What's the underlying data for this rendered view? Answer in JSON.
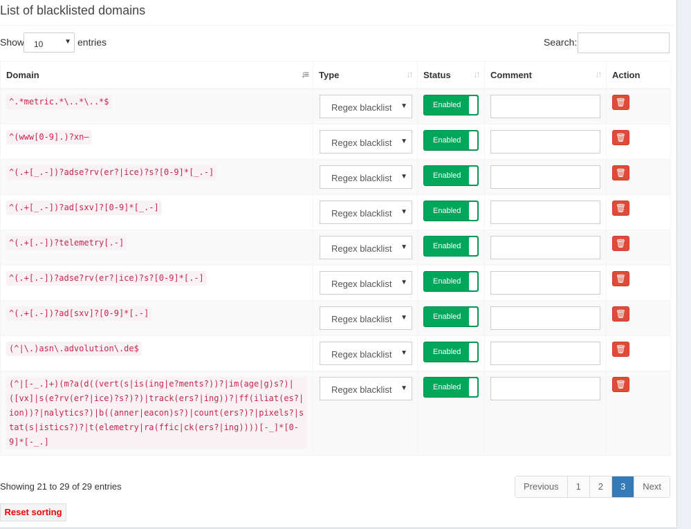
{
  "box": {
    "title": "List of blacklisted domains"
  },
  "controls": {
    "show_label": "Show",
    "entries_label": "entries",
    "length_value": "10",
    "search_label": "Search:"
  },
  "columns": {
    "domain": "Domain",
    "type": "Type",
    "status": "Status",
    "comment": "Comment",
    "action": "Action"
  },
  "rows": [
    {
      "domain": "^.*metric.*\\..*\\..*$",
      "type": "Regex blacklist",
      "status": "Enabled",
      "comment": ""
    },
    {
      "domain": "^(www[0-9].)?xn–",
      "type": "Regex blacklist",
      "status": "Enabled",
      "comment": ""
    },
    {
      "domain": "^(.+[_.-])?adse?rv(er?|ice)?s?[0-9]*[_.-]",
      "type": "Regex blacklist",
      "status": "Enabled",
      "comment": ""
    },
    {
      "domain": "^(.+[_.-])?ad[sxv]?[0-9]*[_.-]",
      "type": "Regex blacklist",
      "status": "Enabled",
      "comment": ""
    },
    {
      "domain": "^(.+[.-])?telemetry[.-]",
      "type": "Regex blacklist",
      "status": "Enabled",
      "comment": ""
    },
    {
      "domain": "^(.+[.-])?adse?rv(er?|ice)?s?[0-9]*[.-]",
      "type": "Regex blacklist",
      "status": "Enabled",
      "comment": ""
    },
    {
      "domain": "^(.+[.-])?ad[sxv]?[0-9]*[.-]",
      "type": "Regex blacklist",
      "status": "Enabled",
      "comment": ""
    },
    {
      "domain": "(^|\\.)asn\\.advolution\\.de$",
      "type": "Regex blacklist",
      "status": "Enabled",
      "comment": ""
    },
    {
      "domain": "(^|[-_.]+)(m?a(d((vert(s|is(ing|e?ments?))?|im(age|g)s?)|([vx]|s(e?rv(er?|ice)?s?)?)|track(ers?|ing))?|ff(iliat(es?|ion))?|nalytics?)|b((anner|eacon)s?)|count(ers?)?|pixels?|stat(s|istics?)?|t(elemetry|ra(ffic|ck(ers?|ing))))[-_]*[0-9]*[-_.]",
      "type": "Regex blacklist",
      "status": "Enabled",
      "comment": ""
    }
  ],
  "info": "Showing 21 to 29 of 29 entries",
  "pagination": {
    "previous": "Previous",
    "pages": [
      "1",
      "2",
      "3"
    ],
    "active_page": "3",
    "next": "Next"
  },
  "reset_label": "Reset sorting",
  "icons": {
    "trash": "trash-icon",
    "sort": "sort-icon",
    "caret": "caret-down-icon"
  },
  "colors": {
    "toggle_on": "#00a65a",
    "delete": "#dd4b39",
    "page_active": "#337ab7",
    "code_text": "#c7254e"
  }
}
